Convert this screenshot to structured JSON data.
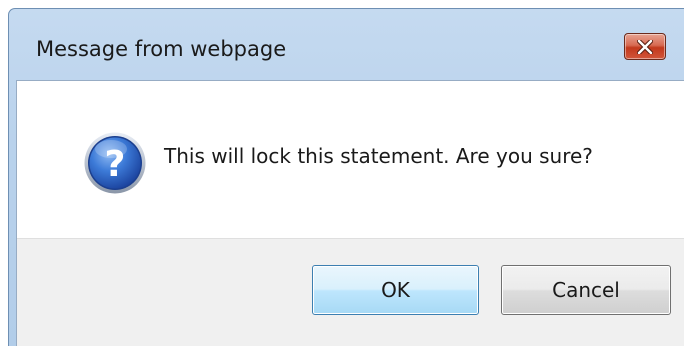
{
  "dialog": {
    "title": "Message from webpage",
    "message": "This will lock this statement.  Are you sure?",
    "icon": "question-icon",
    "buttons": {
      "ok_label": "OK",
      "cancel_label": "Cancel"
    },
    "close_icon": "close-icon"
  },
  "colors": {
    "close_button": "#c7452b",
    "ok_button_border": "#3c7fb1",
    "question_icon": "#2f6bc9",
    "button_area": "#f0f0f0"
  }
}
